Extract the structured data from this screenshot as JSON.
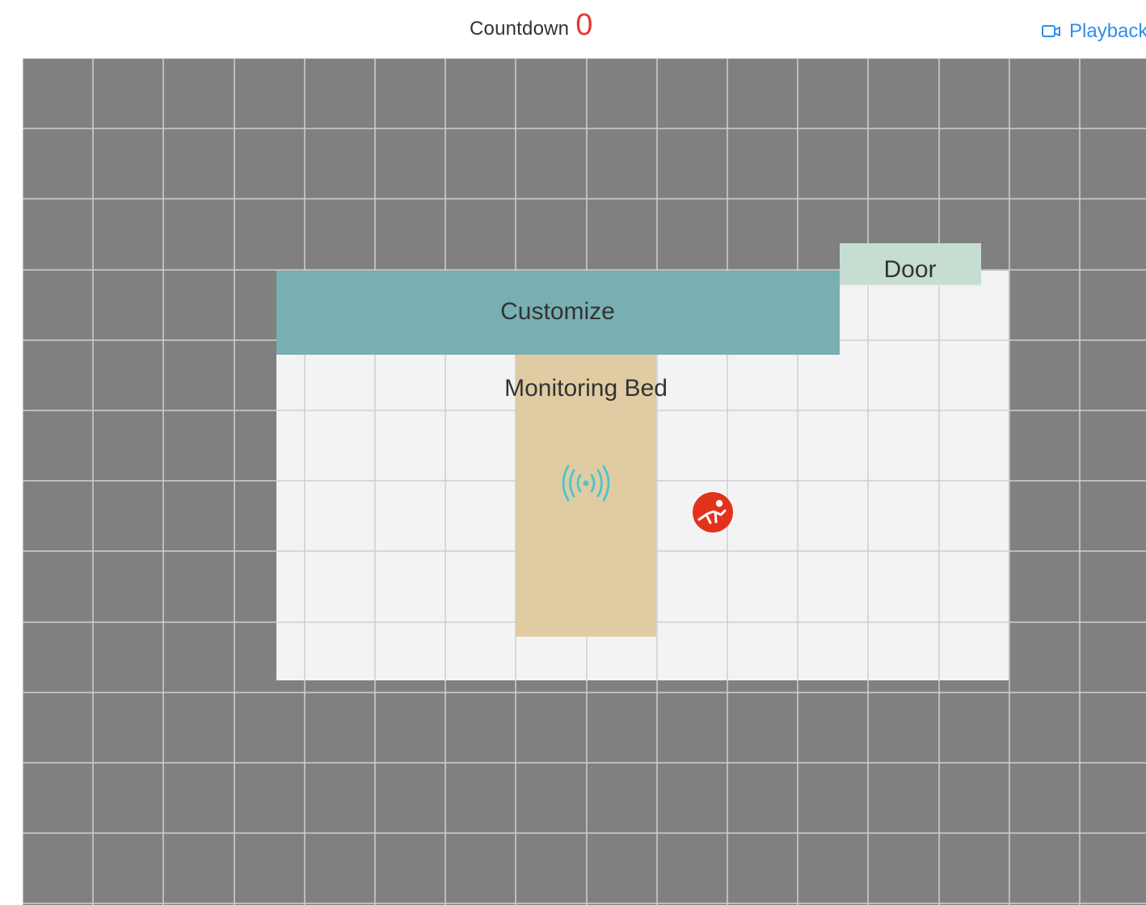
{
  "header": {
    "countdown_label": "Countdown",
    "countdown_value": "0",
    "playback_label": "Playback",
    "playback_icon": "video-camera-icon",
    "colors": {
      "countdown_value": "#e53935",
      "playback": "#2f8fe7"
    }
  },
  "map": {
    "colors": {
      "outside": "#808080",
      "room_floor": "#f3f3f3",
      "grid": "#cfcfcf",
      "customize_zone": "#78afb3",
      "door_zone": "#c6ded1",
      "bed_zone": "#e0cca3",
      "sensor": "#4dc4cc",
      "fall_alert": "#e3321b"
    },
    "zones": {
      "customize": {
        "label": "Customize"
      },
      "door": {
        "label": "Door"
      },
      "monitoring_bed": {
        "label": "Monitoring Bed"
      }
    },
    "icons": {
      "sensor": "radar-sensor-icon",
      "person": "fall-alert-icon"
    }
  }
}
